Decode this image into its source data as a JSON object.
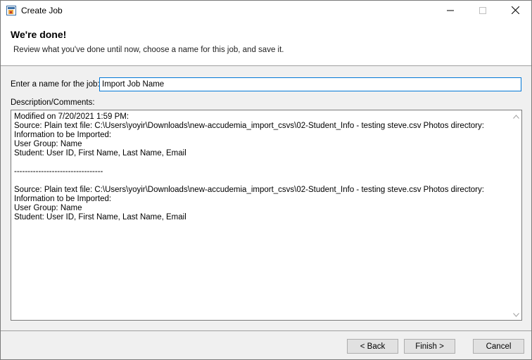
{
  "window": {
    "title": "Create Job",
    "icons": {
      "app": "create-job-app-icon",
      "minimize": "minimize-icon",
      "maximize": "maximize-icon",
      "close": "close-icon"
    }
  },
  "header": {
    "title": "We're done!",
    "subtitle": "Review what you've done until now, choose a name for this job, and save it."
  },
  "form": {
    "name_label": "Enter a name for the job:",
    "name_value": "Import Job Name",
    "description_label": "Description/Comments:",
    "description_text": "Modified on 7/20/2021 1:59 PM:\nSource: Plain text file: C:\\Users\\yoyir\\Downloads\\new-accudemia_import_csvs\\02-Student_Info - testing steve.csv Photos directory:\nInformation to be Imported:\nUser Group: Name\nStudent: User ID, First Name, Last Name, Email\n\n---------------------------------\n\nSource: Plain text file: C:\\Users\\yoyir\\Downloads\\new-accudemia_import_csvs\\02-Student_Info - testing steve.csv Photos directory:\nInformation to be Imported:\nUser Group: Name\nStudent: User ID, First Name, Last Name, Email"
  },
  "buttons": {
    "back": "< Back",
    "finish": "Finish >",
    "cancel": "Cancel"
  },
  "colors": {
    "focus_border": "#0078d7",
    "dialog_bg": "#f0f0f0"
  }
}
